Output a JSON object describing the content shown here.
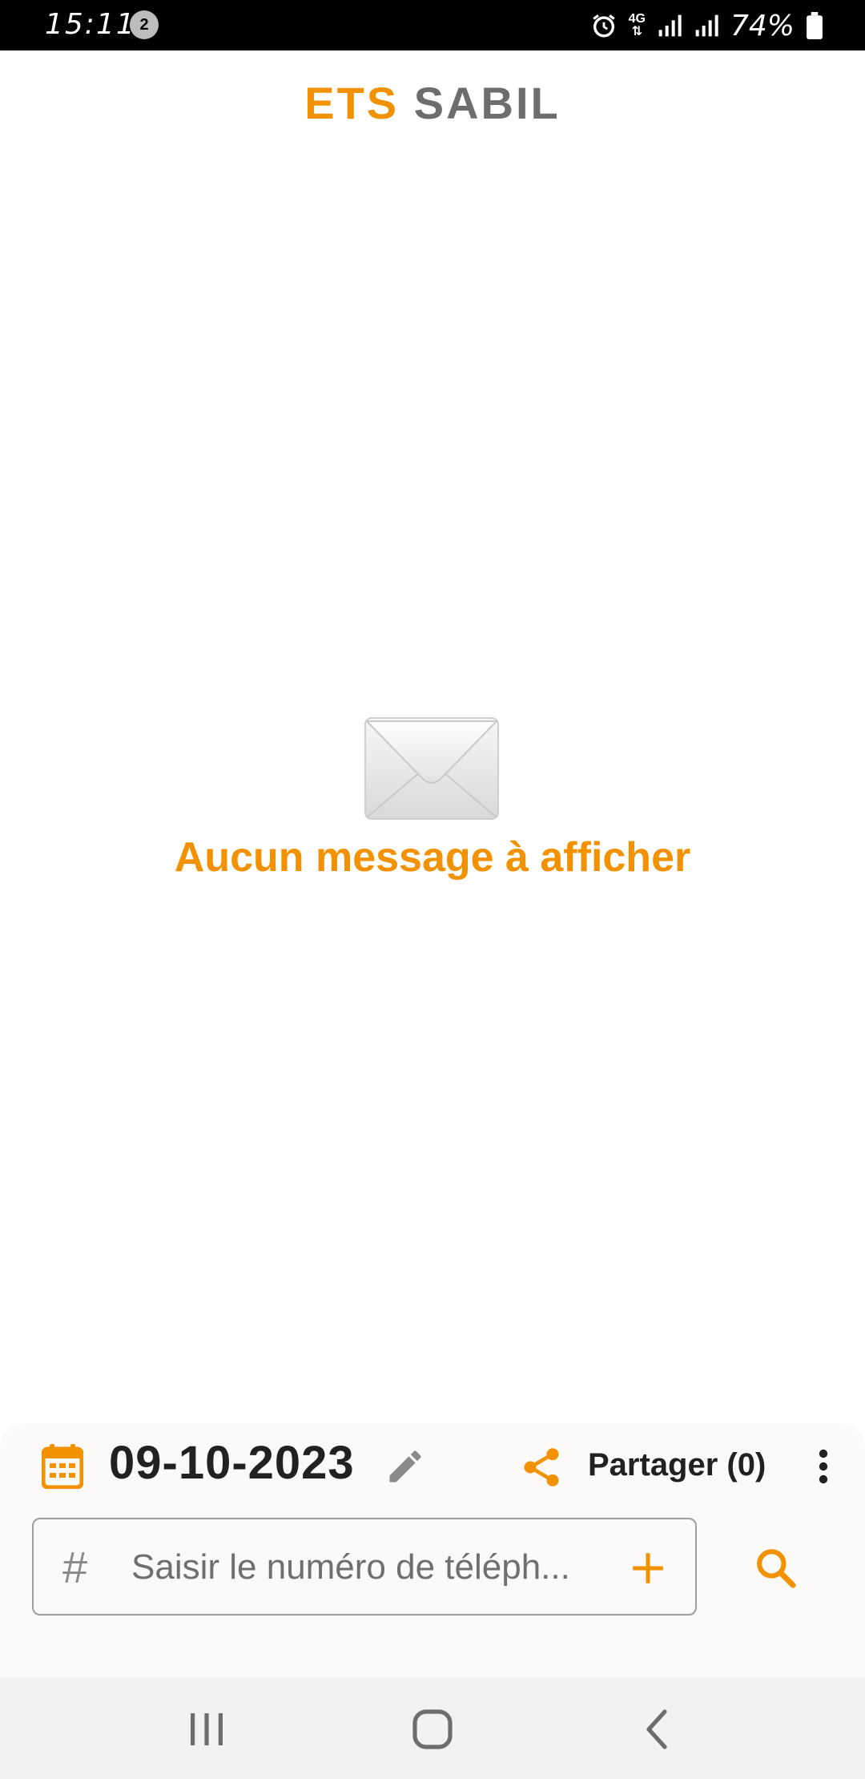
{
  "status_bar": {
    "time": "15:11",
    "notification_badge": "2",
    "network": "4G",
    "battery": "74%"
  },
  "header": {
    "title_part1": "ETS",
    "title_part2": "SABIL",
    "accent_color": "#f39200",
    "secondary_color": "#6d6d6d"
  },
  "empty_state": {
    "icon": "envelope-icon",
    "message": "Aucun message à afficher"
  },
  "toolbar": {
    "date": "09-10-2023",
    "share_label": "Partager (0)"
  },
  "phone_input": {
    "placeholder": "Saisir le numéro de téléph...",
    "value": ""
  },
  "icons": {
    "calendar": "calendar-icon",
    "edit": "pencil-icon",
    "share": "share-icon",
    "more": "more-vertical-icon",
    "hash": "hash-icon",
    "add": "plus-icon",
    "search": "search-icon"
  },
  "nav_bar": {
    "recents": "recents-icon",
    "home": "home-icon",
    "back": "back-icon"
  }
}
